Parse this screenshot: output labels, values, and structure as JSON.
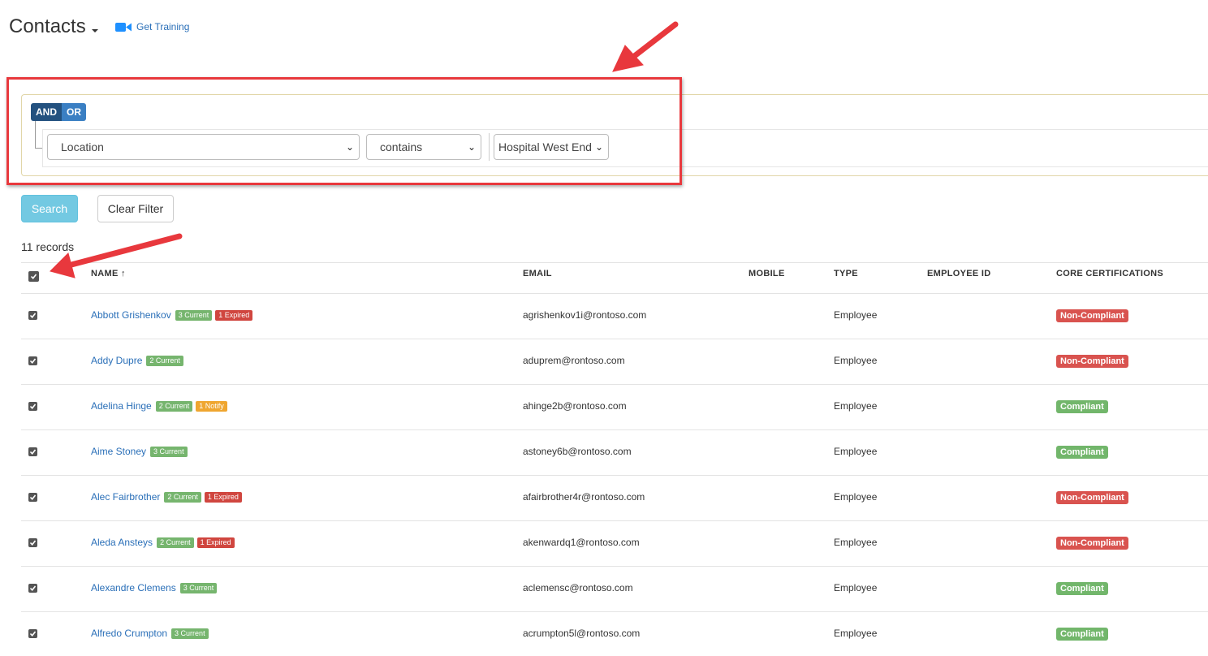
{
  "header": {
    "title": "Contacts",
    "training_link": "Get Training"
  },
  "filter": {
    "and_label": "AND",
    "or_label": "OR",
    "field": "Location",
    "operator": "contains",
    "value": "Hospital West End"
  },
  "actions": {
    "search_label": "Search",
    "clear_label": "Clear Filter"
  },
  "records_count": "11 records",
  "table": {
    "columns": [
      "NAME ↑",
      "EMAIL",
      "MOBILE",
      "TYPE",
      "EMPLOYEE ID",
      "CORE CERTIFICATIONS"
    ],
    "rows": [
      {
        "name": "Abbott Grishenkov",
        "tags": [
          {
            "text": "3 Current",
            "kind": "current"
          },
          {
            "text": "1 Expired",
            "kind": "expired"
          }
        ],
        "email": "agrishenkov1i@rontoso.com",
        "type": "Employee",
        "status": "Non-Compliant",
        "status_kind": "non"
      },
      {
        "name": "Addy Dupre",
        "tags": [
          {
            "text": "2 Current",
            "kind": "current"
          }
        ],
        "email": "aduprem@rontoso.com",
        "type": "Employee",
        "status": "Non-Compliant",
        "status_kind": "non"
      },
      {
        "name": "Adelina Hinge",
        "tags": [
          {
            "text": "2 Current",
            "kind": "current"
          },
          {
            "text": "1 Notify",
            "kind": "notify"
          }
        ],
        "email": "ahinge2b@rontoso.com",
        "type": "Employee",
        "status": "Compliant",
        "status_kind": "ok"
      },
      {
        "name": "Aime Stoney",
        "tags": [
          {
            "text": "3 Current",
            "kind": "current"
          }
        ],
        "email": "astoney6b@rontoso.com",
        "type": "Employee",
        "status": "Compliant",
        "status_kind": "ok"
      },
      {
        "name": "Alec Fairbrother",
        "tags": [
          {
            "text": "2 Current",
            "kind": "current"
          },
          {
            "text": "1 Expired",
            "kind": "expired"
          }
        ],
        "email": "afairbrother4r@rontoso.com",
        "type": "Employee",
        "status": "Non-Compliant",
        "status_kind": "non"
      },
      {
        "name": "Aleda Ansteys",
        "tags": [
          {
            "text": "2 Current",
            "kind": "current"
          },
          {
            "text": "1 Expired",
            "kind": "expired"
          }
        ],
        "email": "akenwardq1@rontoso.com",
        "type": "Employee",
        "status": "Non-Compliant",
        "status_kind": "non"
      },
      {
        "name": "Alexandre Clemens",
        "tags": [
          {
            "text": "3 Current",
            "kind": "current"
          }
        ],
        "email": "aclemensc@rontoso.com",
        "type": "Employee",
        "status": "Compliant",
        "status_kind": "ok"
      },
      {
        "name": "Alfredo Crumpton",
        "tags": [
          {
            "text": "3 Current",
            "kind": "current"
          }
        ],
        "email": "acrumpton5l@rontoso.com",
        "type": "Employee",
        "status": "Compliant",
        "status_kind": "ok"
      }
    ]
  },
  "colors": {
    "annotation": "#e8383d",
    "link": "#2a6fb8",
    "non_compliant": "#d9534f",
    "compliant": "#72b66b"
  }
}
